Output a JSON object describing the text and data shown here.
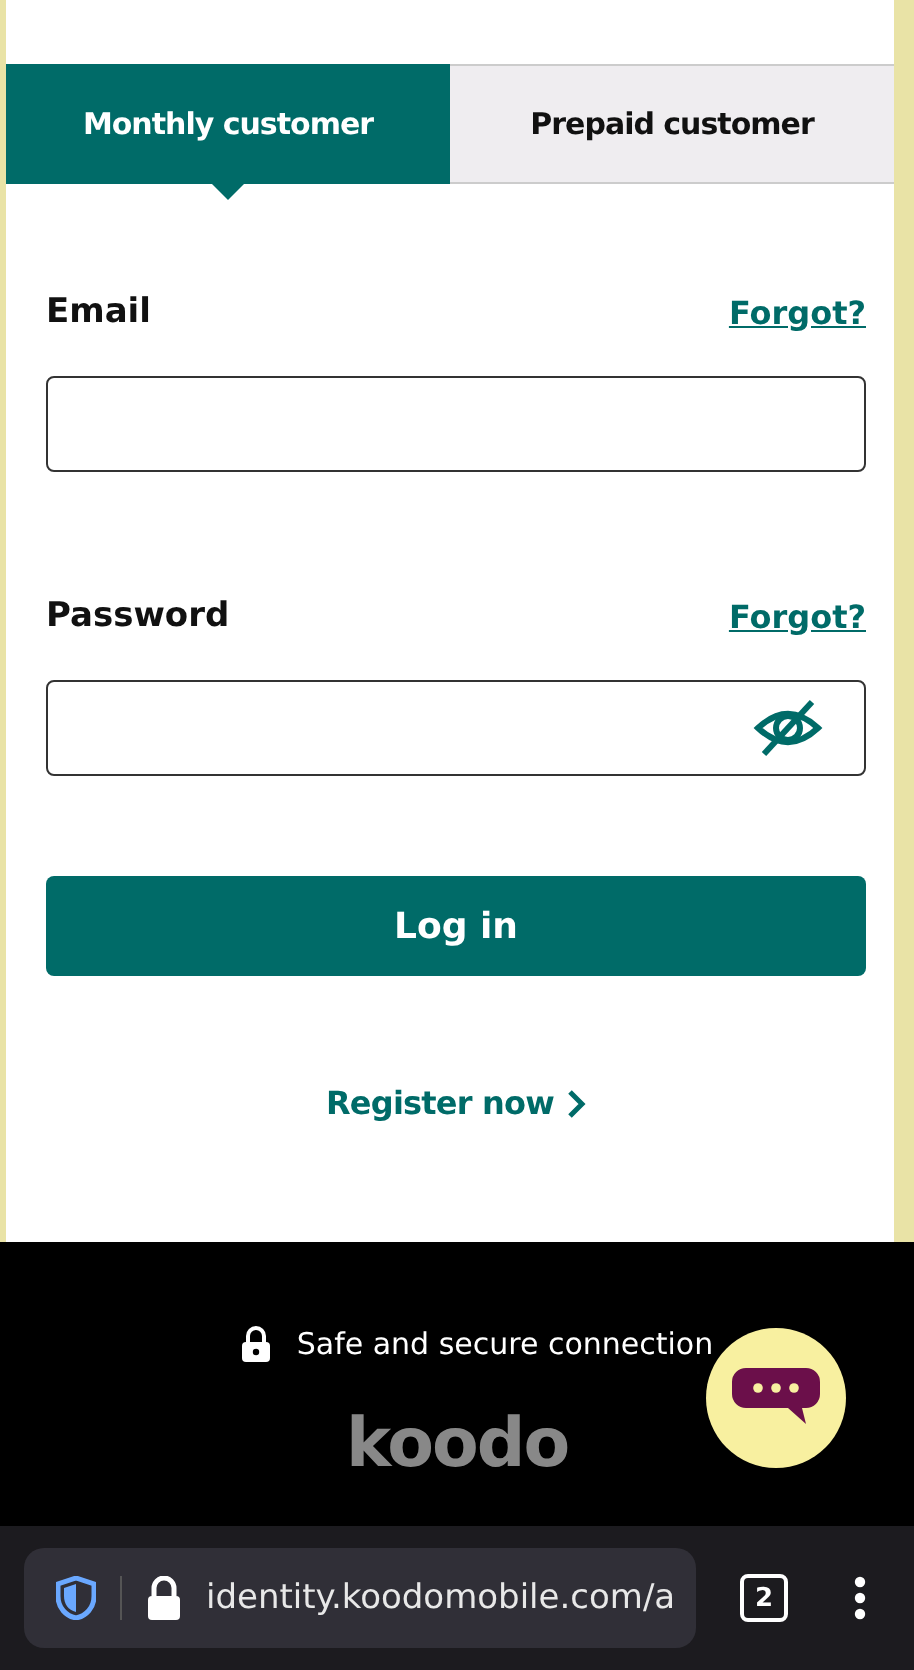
{
  "tabs": [
    {
      "label": "Monthly customer",
      "selected": true
    },
    {
      "label": "Prepaid customer",
      "selected": false
    }
  ],
  "fields": [
    {
      "label": "Email",
      "link": "Forgot?",
      "kind": "text"
    },
    {
      "label": "Password",
      "link": "Forgot?",
      "kind": "password"
    }
  ],
  "login_button": "Log in",
  "register_link": "Register now",
  "footer": {
    "secure_text": "Safe and secure connection",
    "logo": "koodo"
  },
  "browser": {
    "url": "identity.koodomobile.com/a",
    "tab_count": "2"
  }
}
